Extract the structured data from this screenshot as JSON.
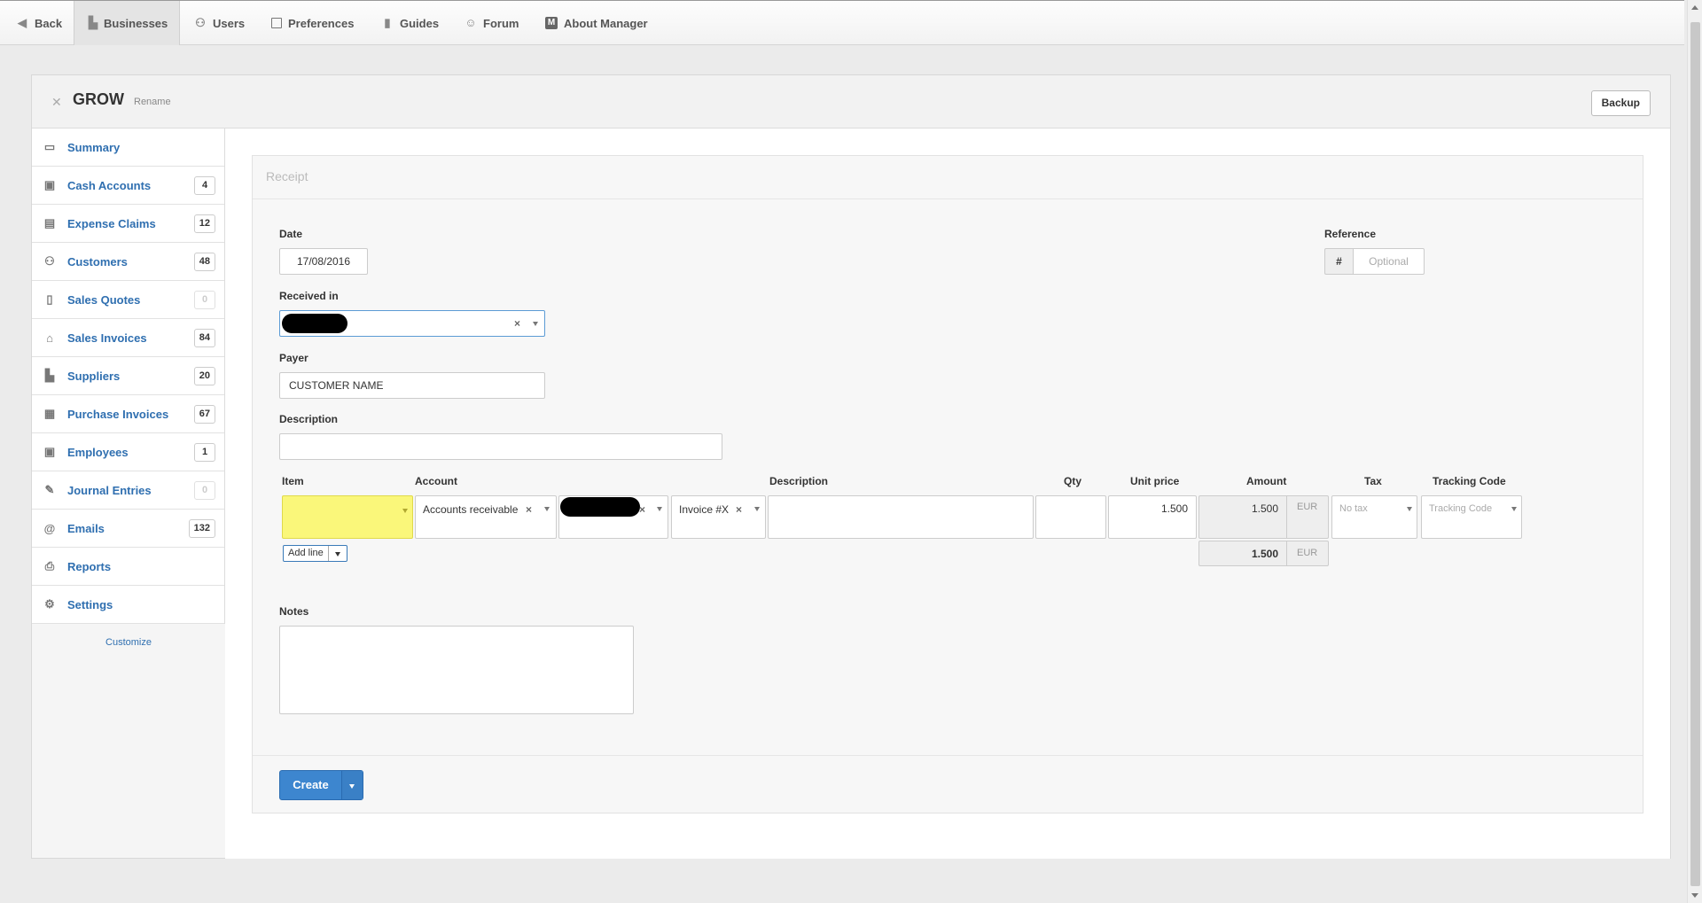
{
  "nav": {
    "items": [
      {
        "label": "Back",
        "icon": "back-arrow-icon"
      },
      {
        "label": "Businesses",
        "icon": "buildings-icon"
      },
      {
        "label": "Users",
        "icon": "users-icon"
      },
      {
        "label": "Preferences",
        "icon": "preferences-icon"
      },
      {
        "label": "Guides",
        "icon": "book-icon"
      },
      {
        "label": "Forum",
        "icon": "chat-icon"
      },
      {
        "label": "About Manager",
        "icon": "manager-logo-icon"
      }
    ]
  },
  "business": {
    "name": "GROW",
    "rename": "Rename",
    "backup": "Backup"
  },
  "sidebar": {
    "items": [
      {
        "label": "Summary",
        "icon": "summary-icon",
        "badge": ""
      },
      {
        "label": "Cash Accounts",
        "icon": "cash-icon",
        "badge": "4"
      },
      {
        "label": "Expense Claims",
        "icon": "wallet-icon",
        "badge": "12"
      },
      {
        "label": "Customers",
        "icon": "customers-icon",
        "badge": "48"
      },
      {
        "label": "Sales Quotes",
        "icon": "quote-icon",
        "badge": "0"
      },
      {
        "label": "Sales Invoices",
        "icon": "inbox-icon",
        "badge": "84"
      },
      {
        "label": "Suppliers",
        "icon": "supplier-icon",
        "badge": "20"
      },
      {
        "label": "Purchase Invoices",
        "icon": "calendar-icon",
        "badge": "67"
      },
      {
        "label": "Employees",
        "icon": "id-card-icon",
        "badge": "1"
      },
      {
        "label": "Journal Entries",
        "icon": "pen-icon",
        "badge": "0"
      },
      {
        "label": "Emails",
        "icon": "at-icon",
        "badge": "132"
      },
      {
        "label": "Reports",
        "icon": "printer-icon",
        "badge": ""
      },
      {
        "label": "Settings",
        "icon": "gears-icon",
        "badge": ""
      }
    ],
    "customize": "Customize"
  },
  "form": {
    "title": "Receipt",
    "date_label": "Date",
    "date_value": "17/08/2016",
    "reference_label": "Reference",
    "reference_hash": "#",
    "reference_placeholder": "Optional",
    "received_in_label": "Received in",
    "payer_label": "Payer",
    "payer_value": "CUSTOMER NAME",
    "description_label": "Description",
    "description_value": "",
    "lines": {
      "headers": {
        "item": "Item",
        "account": "Account",
        "description": "Description",
        "qty": "Qty",
        "unit_price": "Unit price",
        "amount": "Amount",
        "tax": "Tax",
        "tracking": "Tracking Code"
      },
      "row": {
        "account": "Accounts receivable",
        "invoice": "Invoice #X",
        "unit_price": "1.500",
        "amount": "1.500",
        "currency": "EUR",
        "tax_placeholder": "No tax",
        "tracking_placeholder": "Tracking Code"
      },
      "add_line": "Add line",
      "total": "1.500",
      "total_currency": "EUR"
    },
    "notes_label": "Notes",
    "create": "Create"
  },
  "colors": {
    "link": "#2f6fb0",
    "primary_button": "#3d86cf",
    "item_highlight": "#faf77a"
  }
}
